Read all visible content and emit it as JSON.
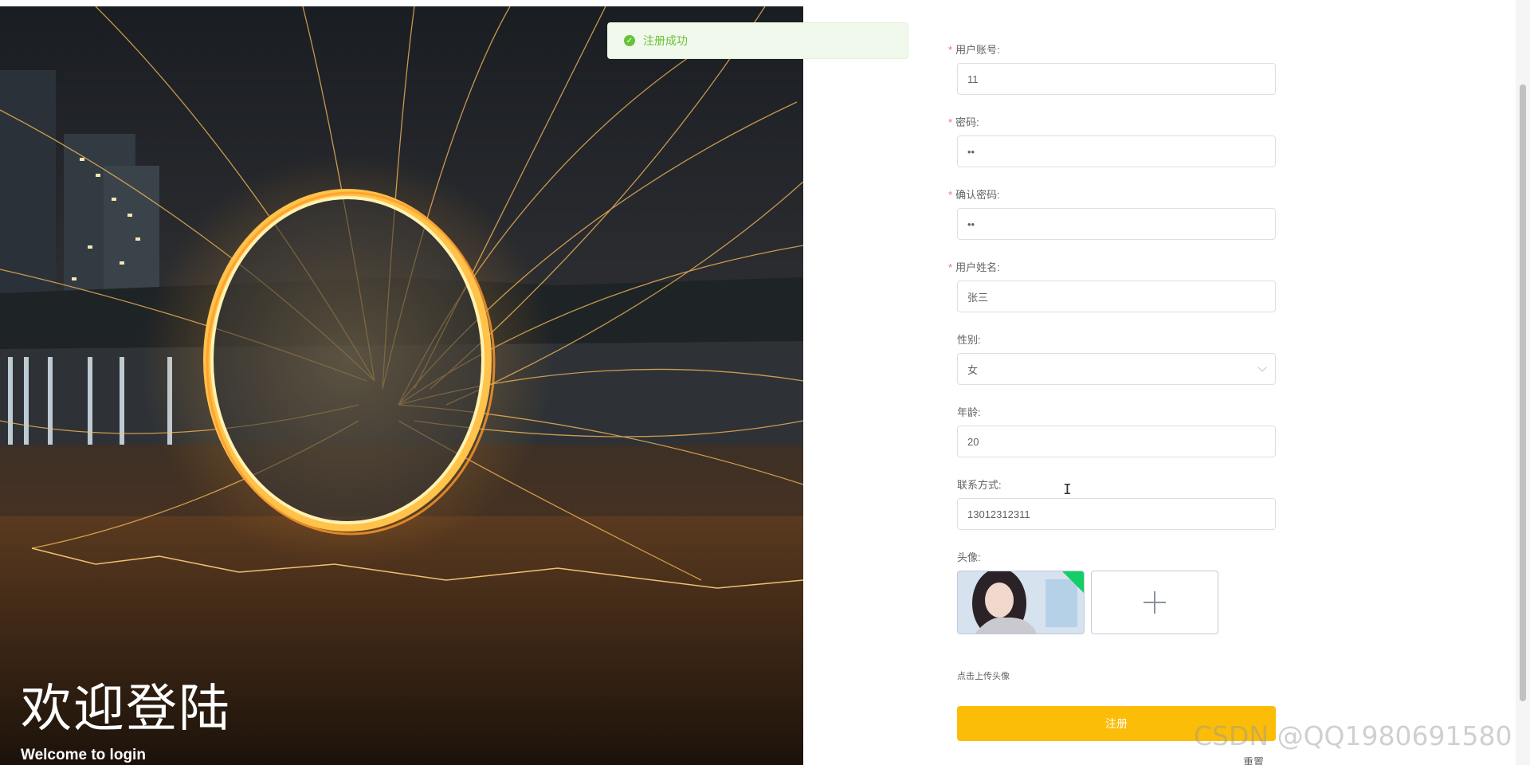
{
  "hero": {
    "title": "欢迎登陆",
    "subtitle": "Welcome to login"
  },
  "toast": {
    "message": "注册成功",
    "color": "#67c23a"
  },
  "form": {
    "fields": {
      "username": {
        "label": "用户账号:",
        "value": "11"
      },
      "password": {
        "label": "密码:",
        "value": "••"
      },
      "confirm_password": {
        "label": "确认密码:",
        "value": "••"
      },
      "real_name": {
        "label": "用户姓名:",
        "value": "张三"
      },
      "gender": {
        "label": "性别:",
        "value": "女"
      },
      "age": {
        "label": "年龄:",
        "value": "20"
      },
      "phone": {
        "label": "联系方式:",
        "value": "13012312311"
      },
      "avatar": {
        "label": "头像:",
        "tip": "点击上传头像"
      }
    },
    "submit_label": "注册",
    "reset_label": "重置",
    "submit_color": "#fbbd08"
  },
  "watermark": "CSDN @QQ1980691580"
}
